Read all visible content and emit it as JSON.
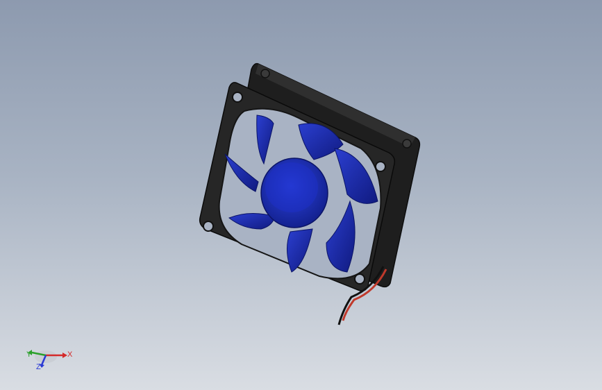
{
  "viewport": {
    "background_top": "#8d9aaf",
    "background_bottom": "#d9dde3"
  },
  "model": {
    "component": "cooling fan",
    "frame_color": "#2a2a2a",
    "blade_color": "#1f2fb8",
    "wire_colors": [
      "#c0392b",
      "#111111"
    ]
  },
  "triad": {
    "x_label": "X",
    "y_label": "Y",
    "z_label": "Z",
    "x_color": "#d42a2a",
    "y_color": "#2aa02a",
    "z_color": "#2a3ad4"
  }
}
